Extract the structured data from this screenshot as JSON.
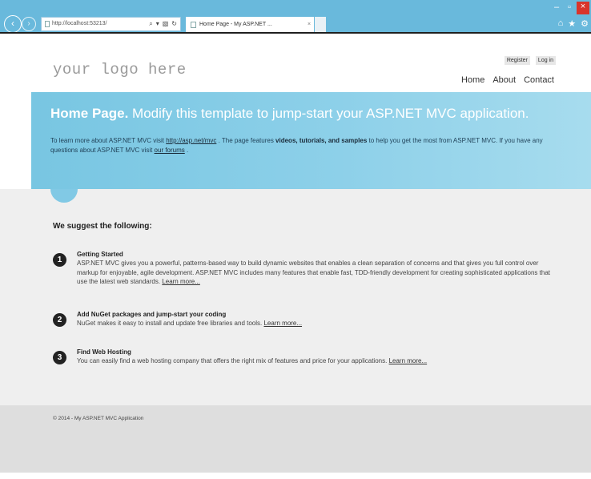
{
  "browser": {
    "address_url": "http://localhost:53213/",
    "address_tools": [
      "⌕",
      "▾",
      "▧",
      "↻"
    ],
    "tab_title": "Home Page - My ASP.NET ...",
    "tab_close": "×",
    "nav_back_glyph": "‹",
    "nav_fwd_glyph": "›",
    "window_controls": [
      "–",
      "▫",
      "×"
    ],
    "right_icons": [
      "⌂",
      "★",
      "⚙"
    ]
  },
  "header": {
    "logo_text": "your logo here",
    "login_links": [
      "Register",
      "Log in"
    ],
    "menu": [
      "Home",
      "About",
      "Contact"
    ]
  },
  "featured": {
    "title_bold": "Home Page.",
    "title_rest": " Modify this template to jump-start your ASP.NET MVC application.",
    "body_part1": "To learn more about ASP.NET MVC visit ",
    "link_mvc": "http://asp.net/mvc",
    "body_part2": " . The page features ",
    "emphasis": "videos, tutorials, and samples",
    "body_part3": " to help you get the most from ASP.NET MVC. If you have any questions about ASP.NET MVC visit ",
    "link_forums": "our forums",
    "body_part4": " ."
  },
  "main": {
    "heading": "We suggest the following:",
    "steps": [
      {
        "number": "1",
        "title": "Getting Started",
        "text": "ASP.NET MVC gives you a powerful, patterns-based way to build dynamic websites that enables a clean separation of concerns and that gives you full control over markup for enjoyable, agile development. ASP.NET MVC includes many features that enable fast, TDD-friendly development for creating sophisticated applications that use the latest web standards. ",
        "link": "Learn more..."
      },
      {
        "number": "2",
        "title": "Add NuGet packages and jump-start your coding",
        "text": "NuGet makes it easy to install and update free libraries and tools. ",
        "link": "Learn more..."
      },
      {
        "number": "3",
        "title": "Find Web Hosting",
        "text": "You can easily find a web hosting company that offers the right mix of features and price for your applications. ",
        "link": "Learn more..."
      }
    ]
  },
  "footer": {
    "text": "© 2014 - My ASP.NET MVC Application"
  }
}
